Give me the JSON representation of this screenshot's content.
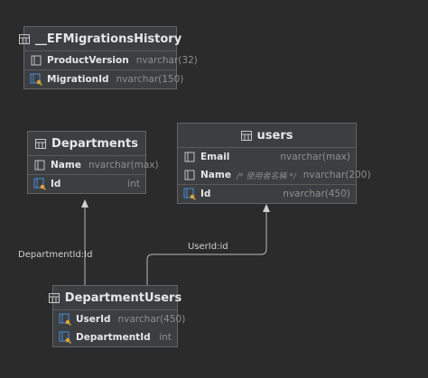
{
  "tables": {
    "efmig": {
      "title": "__EFMigrationsHistory",
      "columns": [
        {
          "name": "ProductVersion",
          "type": "nvarchar(32)",
          "icon": "column-icon"
        },
        {
          "name": "MigrationId",
          "type": "nvarchar(150)",
          "icon": "primary-key-icon"
        }
      ]
    },
    "departments": {
      "title": "Departments",
      "columns": [
        {
          "name": "Name",
          "type": "nvarchar(max)",
          "icon": "column-icon"
        },
        {
          "name": "Id",
          "type": "int",
          "icon": "primary-key-icon"
        }
      ]
    },
    "users": {
      "title": "users",
      "columns": [
        {
          "name": "Email",
          "type": "nvarchar(max)",
          "icon": "column-icon"
        },
        {
          "name": "Name",
          "comment": "/* 使用者名稱 */",
          "type": "nvarchar(200)",
          "icon": "column-icon"
        },
        {
          "name": "Id",
          "type": "nvarchar(450)",
          "icon": "primary-key-icon"
        }
      ]
    },
    "departmentusers": {
      "title": "DepartmentUsers",
      "columns": [
        {
          "name": "UserId",
          "type": "nvarchar(450)",
          "icon": "primary-key-icon"
        },
        {
          "name": "DepartmentId",
          "type": "int",
          "icon": "primary-key-icon"
        }
      ]
    }
  },
  "relations": [
    {
      "label": "DepartmentId:Id"
    },
    {
      "label": "UserId:id"
    }
  ],
  "colors": {
    "background": "#2b2b2b",
    "table_bg": "#3c3f41",
    "key_icon": "#4a8cd8",
    "key_gold": "#d9a33a",
    "connector": "#b8b8b8"
  }
}
